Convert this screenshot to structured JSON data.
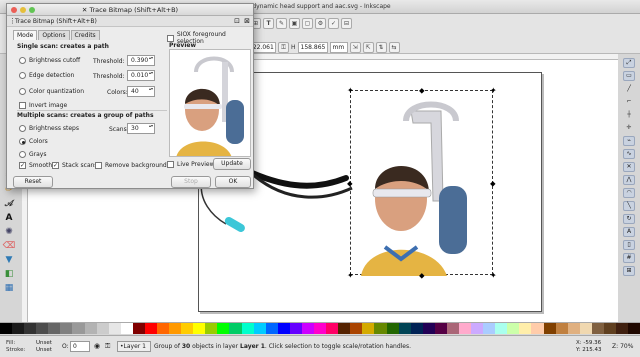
{
  "window": {
    "title": "*dynamic head support and aac.svg - Inkscape"
  },
  "toolbar": {
    "x_label": "X",
    "w_value": "122.061",
    "h_label": "H",
    "h_value": "158.865",
    "unit": "mm"
  },
  "dialog": {
    "title": "Trace Bitmap (Shift+Alt+B)",
    "dock_title": "Trace Bitmap (Shift+Alt+B)",
    "tabs": [
      "Mode",
      "Options",
      "Credits"
    ],
    "siox_label": "SIOX foreground selection",
    "preview_label": "Preview",
    "single_scan_title": "Single scan: creates a path",
    "brightness_cutoff": "Brightness cutoff",
    "edge_detection": "Edge detection",
    "color_quantization": "Color quantization",
    "invert_image": "Invert image",
    "threshold_label": "Threshold:",
    "threshold1": "0.390",
    "threshold2": "0.010",
    "colors_label": "Colors:",
    "colors_value": "40",
    "multi_scan_title": "Multiple scans: creates a group of paths",
    "brightness_steps": "Brightness steps",
    "scans_label": "Scans:",
    "scans_value": "30",
    "colors_option": "Colors",
    "grays_option": "Grays",
    "smooth": "Smooth",
    "stack_scans": "Stack scans",
    "remove_background": "Remove background",
    "live_preview": "Live Preview",
    "update": "Update",
    "reset": "Reset",
    "stop": "Stop",
    "ok": "OK"
  },
  "status": {
    "fill_label": "Fill:",
    "stroke_label": "Stroke:",
    "fill_value": "Unset",
    "stroke_value": "Unset",
    "opacity_label": "O:",
    "opacity_value": "0",
    "layer": "•Layer 1",
    "message_pre": "Group of ",
    "message_count": "30",
    "message_mid": " objects in layer ",
    "message_layer": "Layer 1",
    "message_post": ". Click selection to toggle scale/rotation handles.",
    "coord_x": "X: -59.36",
    "coord_y": "Y: 215.43",
    "zoom_label": "Z:",
    "zoom_value": "70%"
  },
  "colors": {
    "accent_check": "#3b76c4",
    "tool_active": "#c9d2e0"
  },
  "icons": {
    "left_tools": [
      "pen-icon",
      "pencil-icon",
      "calligraphy-icon",
      "text-icon",
      "spray-icon",
      "eraser-icon",
      "bucket-icon",
      "gradient-icon",
      "mesh-icon"
    ],
    "right_tools": [
      "snap-icon",
      "snap-bbox-icon",
      "snap-edge-icon",
      "snap-corner-icon",
      "snap-midpoint-icon",
      "snap-center-icon",
      "snap-node-icon",
      "snap-path-icon",
      "snap-intersection-icon",
      "snap-cusp-icon",
      "snap-smooth-icon",
      "snap-line-icon",
      "snap-rotation-icon",
      "snap-text-icon",
      "snap-page-icon",
      "snap-grid-icon",
      "snap-guide-icon"
    ]
  }
}
